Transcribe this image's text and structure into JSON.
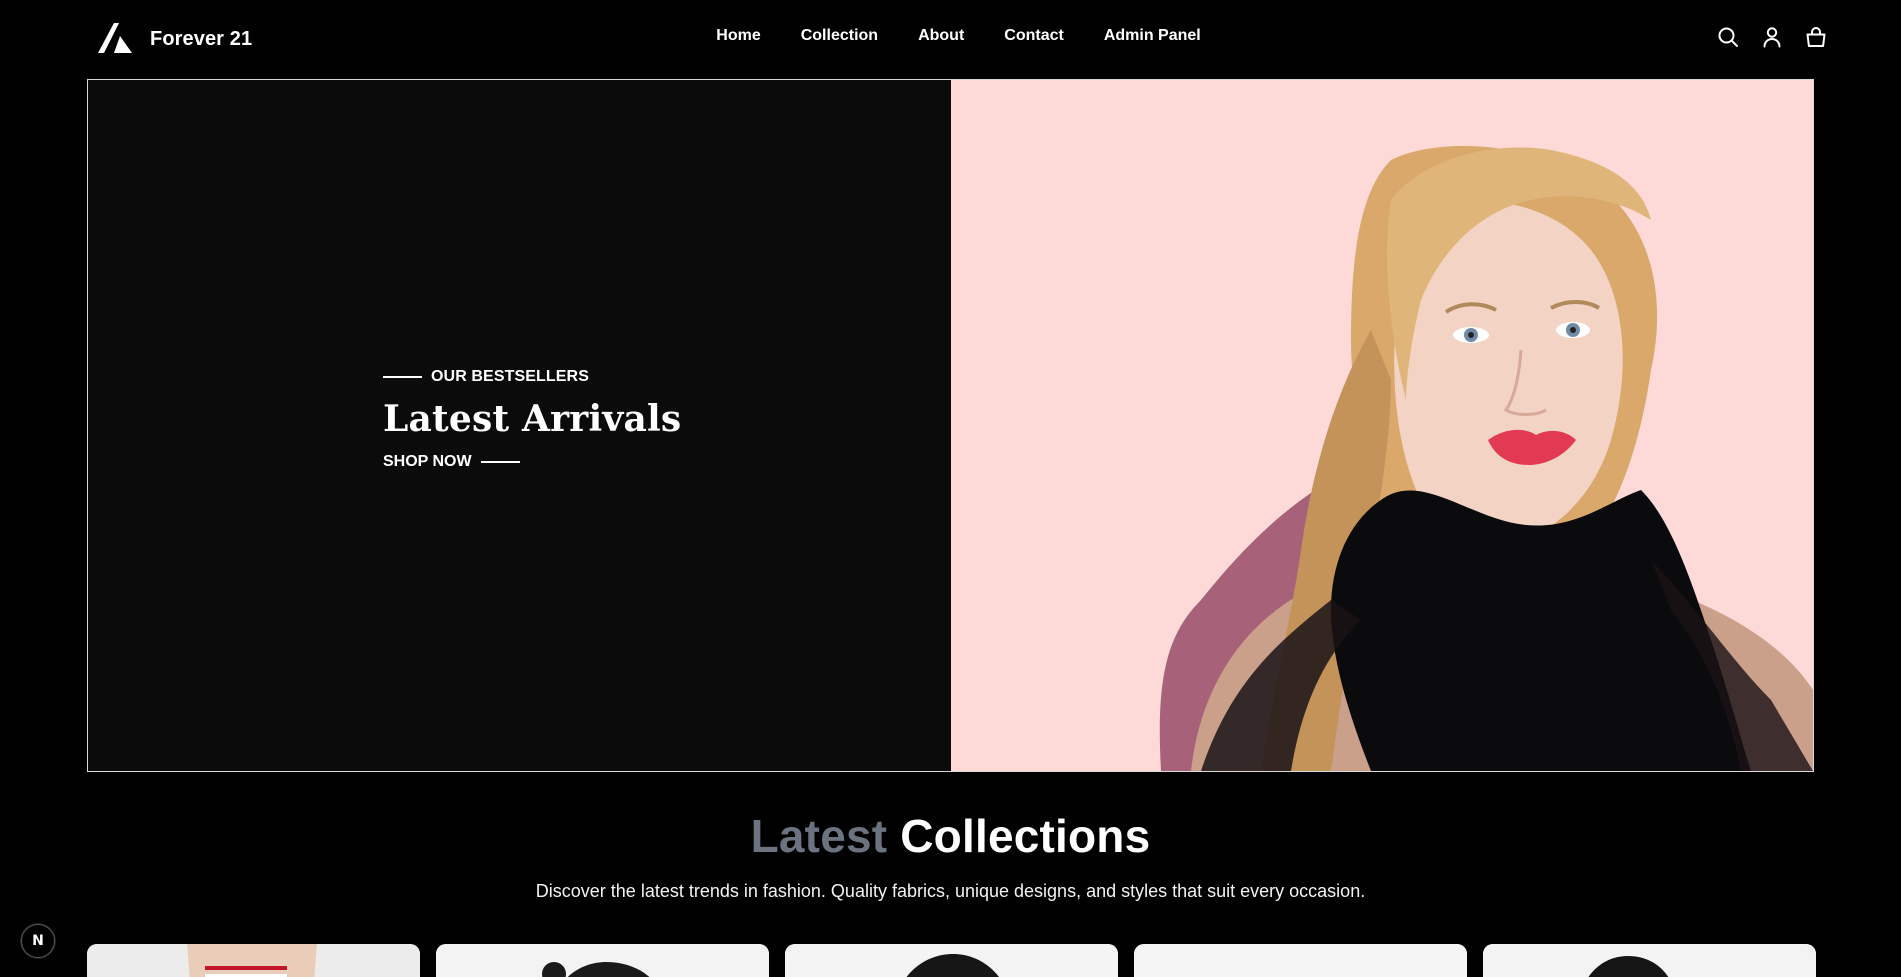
{
  "brand": {
    "name": "Forever 21",
    "logo_icon": "triangle-logo-icon"
  },
  "nav": {
    "links": [
      {
        "label": "Home"
      },
      {
        "label": "Collection"
      },
      {
        "label": "About"
      },
      {
        "label": "Contact"
      },
      {
        "label": "Admin Panel"
      }
    ],
    "icons": [
      "search-icon",
      "user-icon",
      "shopping-bag-icon"
    ]
  },
  "hero": {
    "eyebrow": "OUR BESTSELLERS",
    "title": "Latest Arrivals",
    "cta": "SHOP NOW",
    "image_bg": "#fdd9d7"
  },
  "collections": {
    "title_muted": "Latest",
    "title_bright": "Collections",
    "subtitle": "Discover the latest trends in fashion. Quality fabrics, unique designs, and styles that suit every occasion."
  },
  "badge": {
    "label": "N"
  },
  "colors": {
    "background": "#000000",
    "hero_panel": "#0b0b0c",
    "hero_image_bg": "#fdd9d7",
    "muted_text": "#6b7280"
  }
}
